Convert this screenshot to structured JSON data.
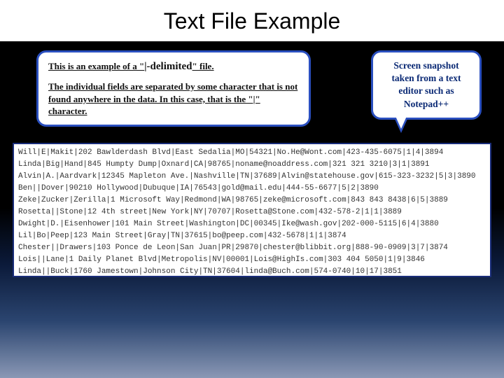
{
  "title": "Text File Example",
  "callout_left": {
    "line1_pre": "This is an example of a \"",
    "line1_delim": "|-delimited",
    "line1_post": "\" file.",
    "para2": "The individual fields are separated by some character that is not found anywhere in the data.  In this case, that is the \"|\" character."
  },
  "callout_right": "Screen snapshot taken from a text editor such as Notepad++",
  "rows": [
    "Will|E|Makit|202 Bawlderdash Blvd|East Sedalia|MO|54321|No.He@Wont.com|423-435-6075|1|4|3894",
    "Linda|Big|Hand|845 Humpty Dump|Oxnard|CA|98765|noname@noaddress.com|321 321 3210|3|1|3891",
    "Alvin|A.|Aardvark|12345 Mapleton Ave.|Nashville|TN|37689|Alvin@statehouse.gov|615-323-3232|5|3|3890",
    "Ben||Dover|90210 Hollywood|Dubuque|IA|76543|gold@mail.edu|444-55-6677|5|2|3890",
    "Zeke|Zucker|Zerilla|1 Microsoft Way|Redmond|WA|98765|zeke@microsoft.com|843 843 8438|6|5|3889",
    "Rosetta||Stone|12 4th street|New York|NY|70707|Rosetta@Stone.com|432-578-2|1|1|3889",
    "Dwight|D.|Eisenhower|101 Main Street|Washington|DC|00345|Ike@wash.gov|202-000-5115|6|4|3880",
    "Lil|Bo|Peep|123 Main Street|Gray|TN|37615|bo@peep.com|432-5678|1|1|3874",
    "Chester||Drawers|103 Ponce de Leon|San Juan|PR|29870|chester@blibbit.org|888-90-0909|3|7|3874",
    "Lois||Lane|1 Daily Planet Blvd|Metropolis|NV|00001|Lois@HighIs.com|303 404 5050|1|9|3846",
    "Linda||Buck|1760 Jamestown|Johnson City|TN|37604|linda@Buch.com|574-0740|10|17|3851"
  ]
}
